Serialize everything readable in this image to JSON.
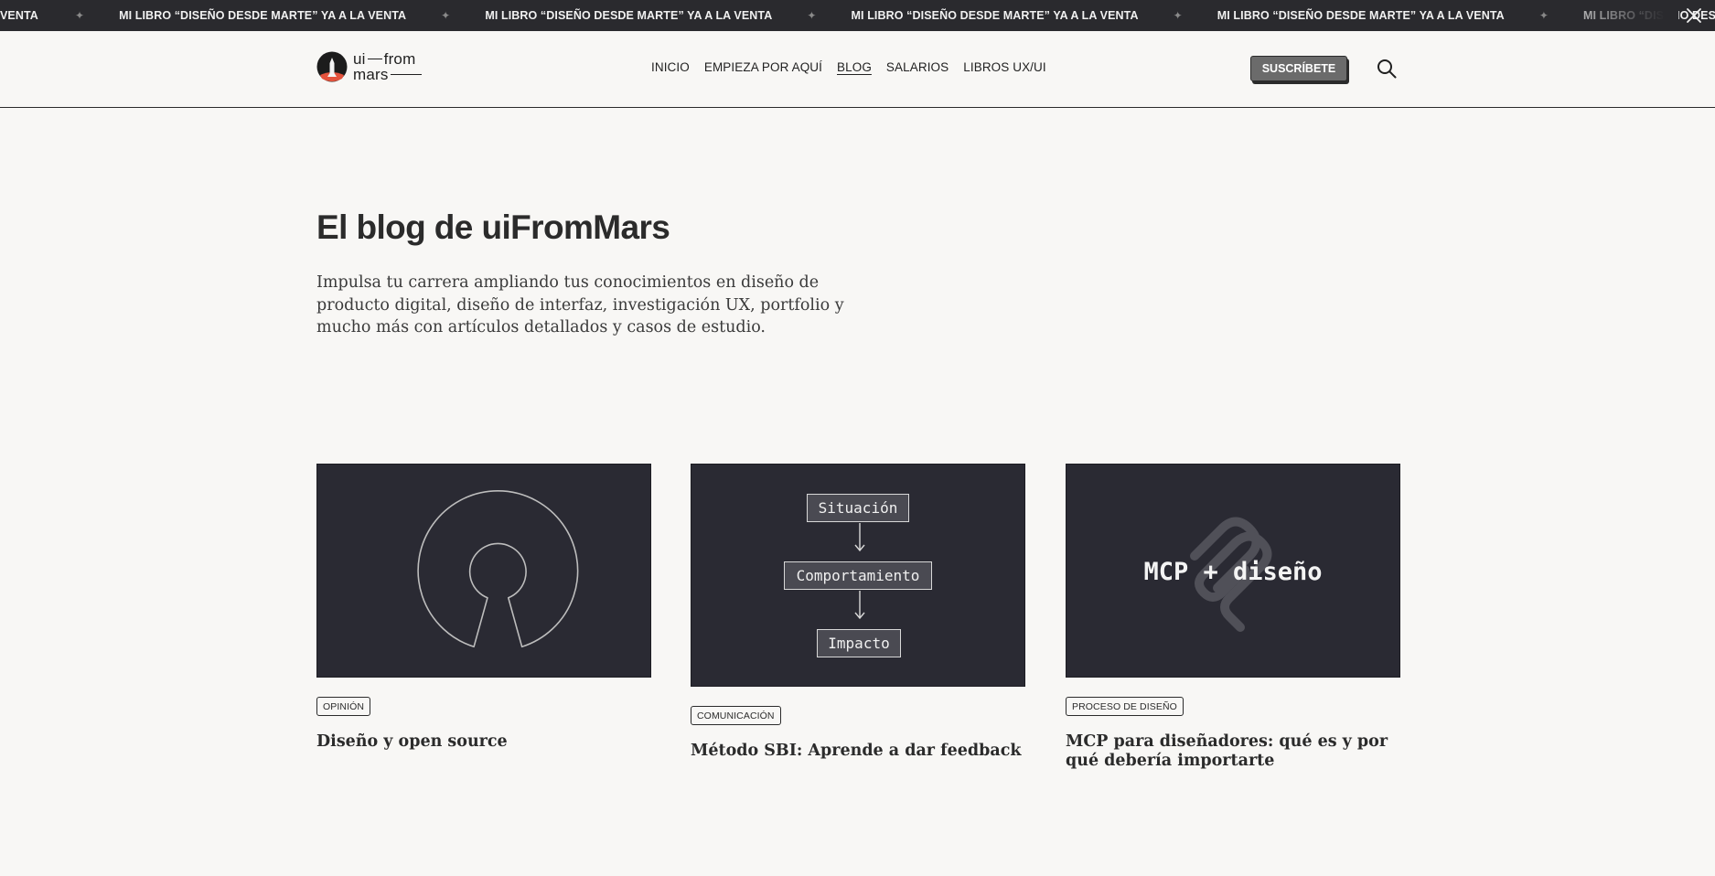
{
  "banner": {
    "lead_text": "VENTA",
    "items": [
      "MI LIBRO “DISEÑO DESDE MARTE” YA A LA VENTA",
      "MI LIBRO “DISEÑO DESDE MARTE” YA A LA VENTA",
      "MI LIBRO “DISEÑO DESDE MARTE” YA A LA VENTA",
      "MI LIBRO “DISEÑO DESDE MARTE” YA A LA VENTA",
      "MI LIBRO “DISEÑO DESDE MARTE” YA A LA VENTA"
    ],
    "separator": "✦",
    "close_icon": "close-icon"
  },
  "header": {
    "logo": {
      "line1": "ui—from",
      "line1_a": "ui",
      "line1_b": "from",
      "line2": "mars"
    },
    "nav": [
      {
        "label": "INICIO",
        "active": false
      },
      {
        "label": "EMPIEZA POR AQUÍ",
        "active": false
      },
      {
        "label": "BLOG",
        "active": true
      },
      {
        "label": "SALARIOS",
        "active": false
      },
      {
        "label": "LIBROS UX/UI",
        "active": false
      }
    ],
    "subscribe_label": "SUSCRÍBETE",
    "search_icon": "search-icon"
  },
  "hero": {
    "title": "El blog de uiFromMars",
    "description": "Impulsa tu carrera ampliando tus conocimientos en diseño de producto digital, diseño de interfaz, investigación UX, portfolio y mucho más con artículos detallados y casos de estudio."
  },
  "posts": [
    {
      "tag": "OPINIÓN",
      "title": "Diseño y open source",
      "image": "open-source-logo"
    },
    {
      "tag": "COMUNICACIÓN",
      "title": "Método SBI: Aprende a dar feedback",
      "image": "sbi-flow-diagram",
      "flow": [
        "Situación",
        "Comportamiento",
        "Impacto"
      ]
    },
    {
      "tag": "PROCESO DE DISEÑO",
      "title": "MCP para diseñadores: qué es y por qué debería importarte",
      "image": "mcp-logo",
      "image_text": "MCP + diseño"
    }
  ],
  "colors": {
    "background": "#f8f7f5",
    "banner": "#2a2a2e",
    "card_image": "#2a2a33",
    "subscribe": "#6b6b6b",
    "text": "#2b2b2b"
  }
}
